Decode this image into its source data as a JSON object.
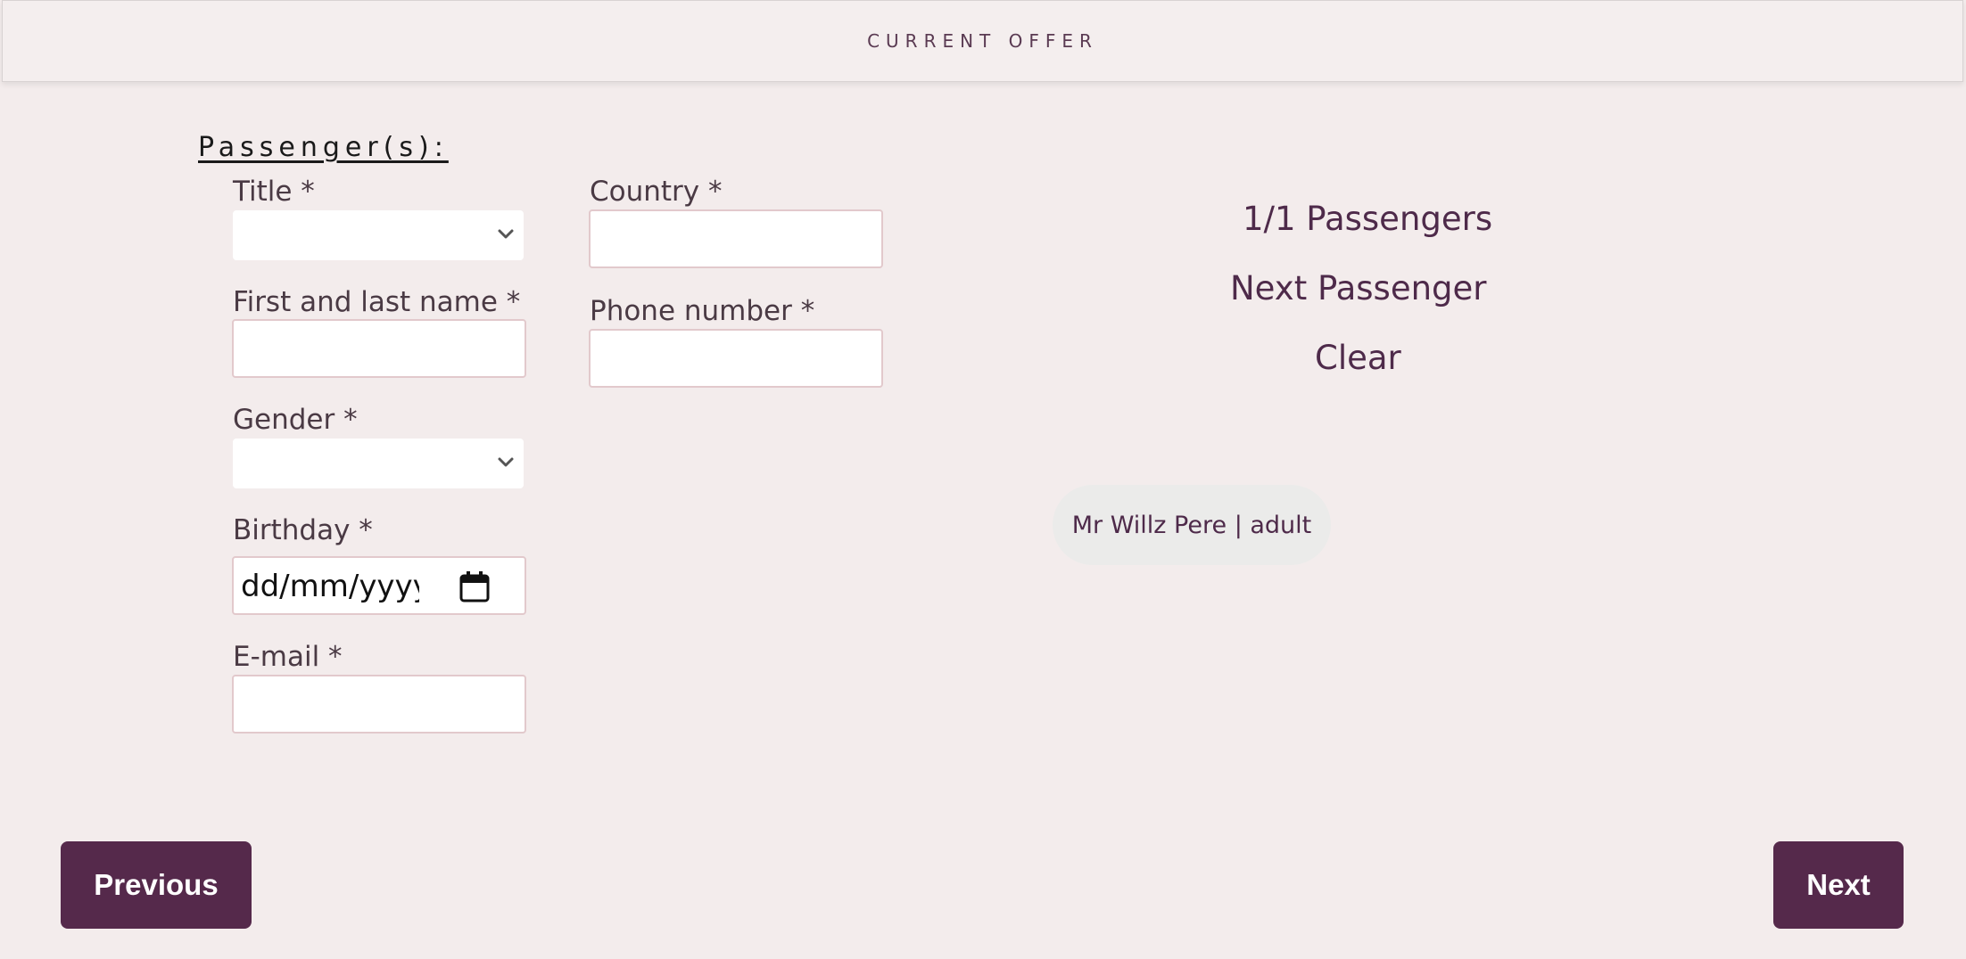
{
  "header": {
    "title": "CURRENT OFFER"
  },
  "passengers_form": {
    "heading": "Passenger(s):",
    "title_label": "Title *",
    "title_value": "",
    "name_label": "First and last name *",
    "name_value": "",
    "gender_label": "Gender *",
    "gender_value": "",
    "birthday_label": "Birthday *",
    "birthday_placeholder": "dd/mm/yyyy",
    "email_label": "E-mail *",
    "email_value": "",
    "country_label": "Country *",
    "country_value": "",
    "phone_label": "Phone number *",
    "phone_value": ""
  },
  "summary": {
    "count": "1/1 Passengers",
    "next_passenger": "Next Passenger",
    "clear": "Clear",
    "passenger_chip": "Mr Willz Pere | adult"
  },
  "footer": {
    "previous_label": "Previous",
    "next_label": "Next"
  },
  "colors": {
    "background": "#f3ecec",
    "accent": "#55294b",
    "text_accent": "#4e2a4a"
  },
  "icons": {
    "select_chevron": "chevron-down-icon",
    "date_picker": "calendar-icon"
  }
}
